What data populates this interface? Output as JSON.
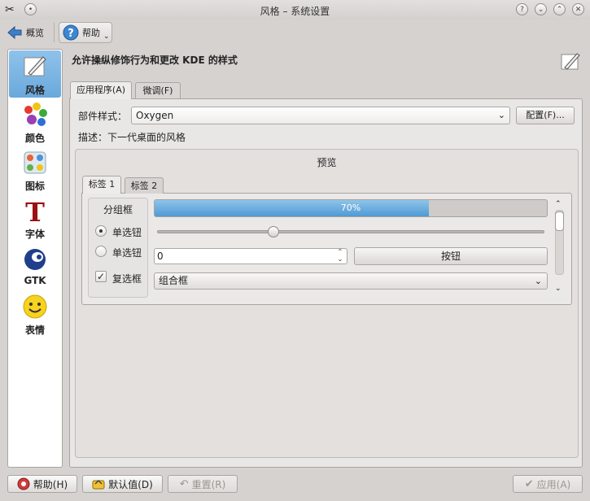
{
  "window": {
    "title": "风格 – 系统设置",
    "controls": [
      "help",
      "minimize",
      "maximize",
      "close"
    ]
  },
  "toolbar": {
    "overview_label": "概览",
    "help_label": "帮助"
  },
  "sidebar": {
    "items": [
      {
        "label": "风格",
        "icon": "style-brush-icon",
        "selected": true
      },
      {
        "label": "颜色",
        "icon": "color-palette-icon",
        "selected": false
      },
      {
        "label": "图标",
        "icon": "icons-icon",
        "selected": false
      },
      {
        "label": "字体",
        "icon": "font-icon",
        "selected": false
      },
      {
        "label": "GTK",
        "icon": "gtk-icon",
        "selected": false
      },
      {
        "label": "表情",
        "icon": "emoticon-icon",
        "selected": false
      }
    ]
  },
  "main": {
    "heading": "允许操纵修饰行为和更改 KDE 的样式",
    "tabs": [
      {
        "label": "应用程序(A)",
        "active": true
      },
      {
        "label": "微调(F)",
        "active": false
      }
    ],
    "widget_style_label": "部件样式：",
    "widget_style_value": "Oxygen",
    "configure_label": "配置(F)...",
    "description": "描述：下一代桌面的风格",
    "preview": {
      "title": "预览",
      "tabs": [
        {
          "label": "标签 1",
          "active": true
        },
        {
          "label": "标签 2",
          "active": false
        }
      ],
      "groupbox_title": "分组框",
      "radio1_label": "单选钮",
      "radio2_label": "单选钮",
      "checkbox_label": "复选框",
      "progress_text": "70%",
      "progress_fraction": 0.7,
      "slider_fraction": 0.3,
      "spin_value": "0",
      "button_label": "按钮",
      "combo_label": "组合框"
    }
  },
  "bottom": {
    "help_label": "帮助(H)",
    "defaults_label": "默认值(D)",
    "reset_label": "重置(R)",
    "apply_label": "应用(A)"
  },
  "colors": {
    "selection": "#6aa9dc",
    "progress": "#4f9ad4",
    "window_bg": "#d6d2d0"
  }
}
